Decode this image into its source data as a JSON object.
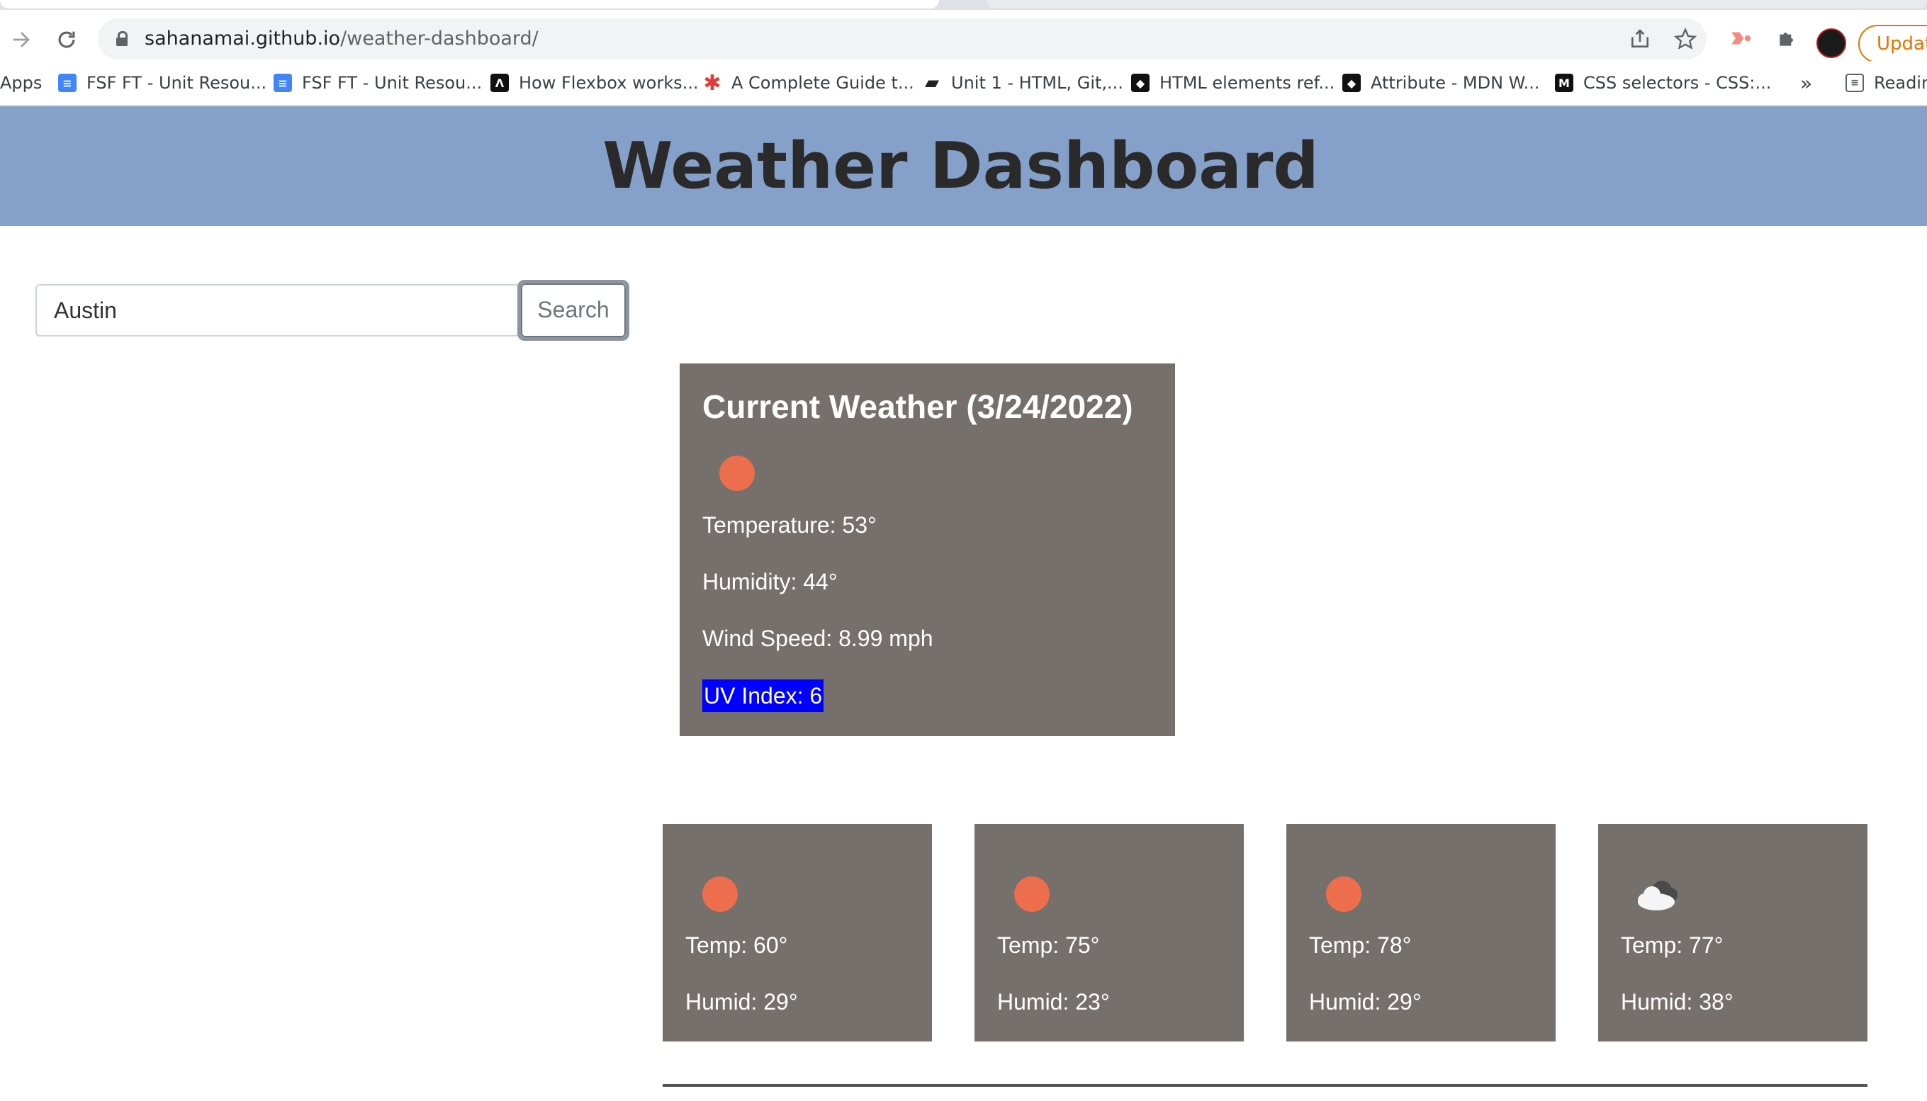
{
  "browser": {
    "url_host": "sahanamai.github.io",
    "url_path": "/weather-dashboard/",
    "update_label": "Update",
    "bookmarks": [
      {
        "label": "Apps",
        "icon": "apps-grid-icon"
      },
      {
        "label": "FSF FT - Unit Resou...",
        "icon": "google-docs-icon"
      },
      {
        "label": "FSF FT - Unit Resou...",
        "icon": "google-docs-icon"
      },
      {
        "label": "How Flexbox works...",
        "icon": "site-favicon"
      },
      {
        "label": "A Complete Guide t...",
        "icon": "css-tricks-star-icon"
      },
      {
        "label": "Unit 1 - HTML, Git,...",
        "icon": "book-icon"
      },
      {
        "label": "HTML elements ref...",
        "icon": "mdn-icon"
      },
      {
        "label": "Attribute - MDN W...",
        "icon": "mdn-icon"
      },
      {
        "label": "CSS selectors - CSS:...",
        "icon": "mdn-m-icon"
      }
    ],
    "overflow_label": "»",
    "reading_list_label": "Readin"
  },
  "page": {
    "title": "Weather Dashboard",
    "search": {
      "value": "Austin",
      "button_label": "Search"
    },
    "current": {
      "heading": "Current Weather (3/24/2022)",
      "icon": "sun-icon",
      "temperature": "Temperature: 53°",
      "humidity": "Humidity: 44°",
      "wind": "Wind Speed: 8.99 mph",
      "uv": "UV Index: 6"
    },
    "forecast": [
      {
        "icon": "sun-icon",
        "temp": "Temp: 60°",
        "humid": "Humid: 29°"
      },
      {
        "icon": "sun-icon",
        "temp": "Temp: 75°",
        "humid": "Humid: 23°"
      },
      {
        "icon": "sun-icon",
        "temp": "Temp: 78°",
        "humid": "Humid: 29°"
      },
      {
        "icon": "cloud-icon",
        "temp": "Temp: 77°",
        "humid": "Humid: 38°"
      }
    ]
  },
  "colors": {
    "header_bg": "#85a0c9",
    "card_bg": "#76706c",
    "sun": "#ec6e4c",
    "uv_highlight": "#0000ff"
  }
}
